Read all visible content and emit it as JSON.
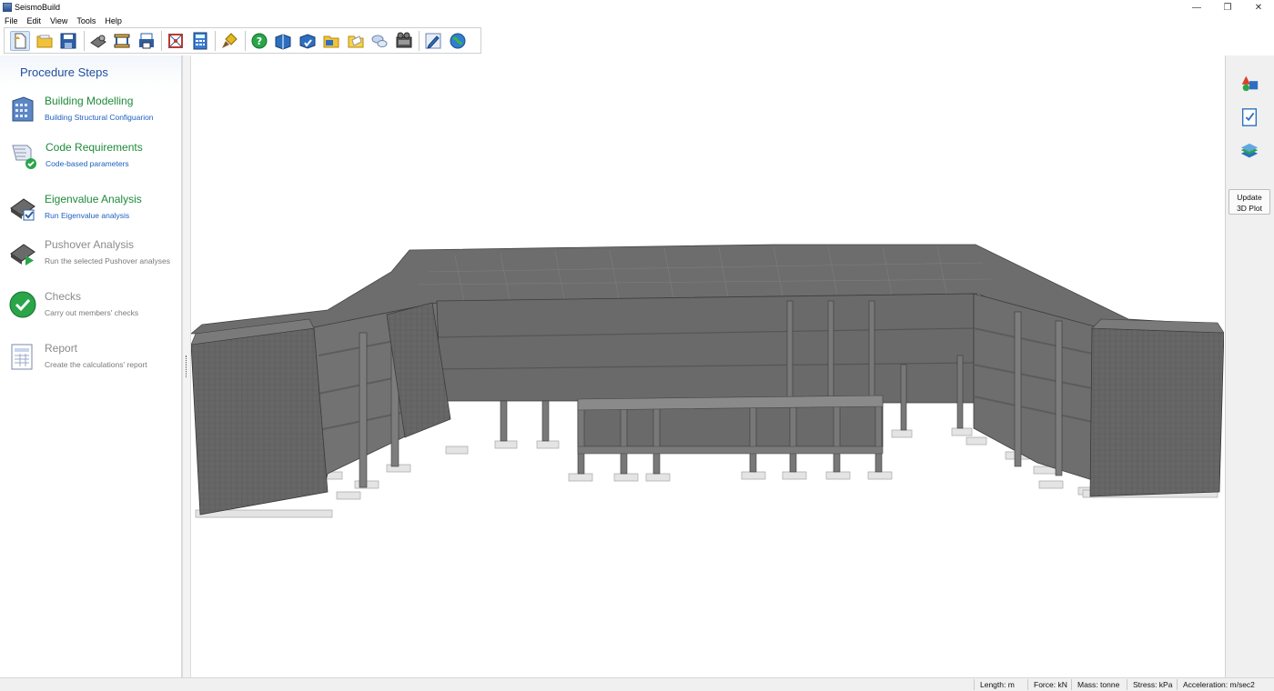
{
  "window": {
    "title": "SeismoBuild",
    "minimize": "—",
    "restore": "❐",
    "close": "✕"
  },
  "menu": [
    {
      "label": "File"
    },
    {
      "label": "Edit"
    },
    {
      "label": "View"
    },
    {
      "label": "Tools"
    },
    {
      "label": "Help"
    }
  ],
  "toolbar": {
    "icons": [
      "new-file-icon",
      "open-folder-icon",
      "save-icon",
      "settings-machine-icon",
      "frame-icon",
      "print-icon",
      "structure-icon",
      "calculator-icon",
      "brush-icon",
      "help-icon",
      "book-icon",
      "book-check-icon",
      "folder-icon",
      "folder-open-icon",
      "chat-icon",
      "film-icon",
      "edit-icon",
      "globe-icon"
    ]
  },
  "left_panel": {
    "header": "Procedure Steps",
    "steps": [
      {
        "title": "Building Modelling",
        "desc": "Building Structural Configuarion",
        "state": "active"
      },
      {
        "title": "Code Requirements",
        "desc": "Code-based parameters",
        "state": "active"
      },
      {
        "title": "Eigenvalue Analysis",
        "desc": "Run Eigenvalue analysis",
        "state": "active"
      },
      {
        "title": "Pushover Analysis",
        "desc": "Run the selected Pushover analyses",
        "state": "inactive"
      },
      {
        "title": "Checks",
        "desc": "Carry out members' checks",
        "state": "inactive"
      },
      {
        "title": "Report",
        "desc": "Create the calculations' report",
        "state": "inactive"
      }
    ]
  },
  "right_panel": {
    "update_line1": "Update",
    "update_line2": "3D Plot",
    "icons": [
      "shapes-icon",
      "checklist-icon",
      "layers-icon"
    ]
  },
  "status": {
    "length": "Length: m",
    "force": "Force: kN",
    "mass": "Mass: tonne",
    "stress": "Stress: kPa",
    "acceleration": "Acceleration: m/sec2"
  },
  "colors": {
    "active_title": "#1d8a3a",
    "active_desc": "#1f5fbf",
    "inactive": "#8a8a8a",
    "header": "#1f4e9c",
    "concrete": "#6b6b6b"
  }
}
